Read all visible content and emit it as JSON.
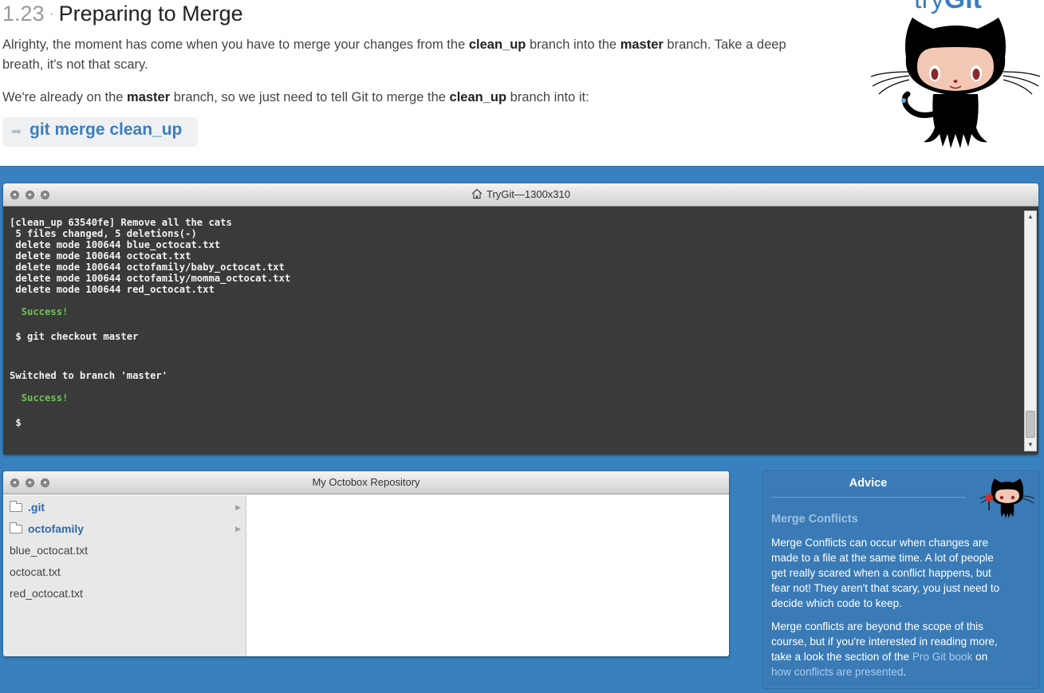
{
  "lesson": {
    "number": "1.23",
    "separator": "·",
    "title": "Preparing to Merge",
    "p1": {
      "a": "Alrighty, the moment has come when you have to merge your changes from the ",
      "b1": "clean_up",
      "c": " branch into the ",
      "b2": "master",
      "d": " branch. Take a deep breath, it's not that scary."
    },
    "p2": {
      "a": "We're already on the ",
      "b1": "master",
      "c": " branch, so we just need to tell Git to merge the ",
      "b2": "clean_up",
      "d": " branch into it:"
    },
    "command": "git merge clean_up"
  },
  "logo": {
    "text_light": "try",
    "text_bold": "Git"
  },
  "terminal": {
    "title": "TryGit—1300x310",
    "lines": [
      "[clean_up 63540fe] Remove all the cats",
      " 5 files changed, 5 deletions(-)",
      " delete mode 100644 blue_octocat.txt",
      " delete mode 100644 octocat.txt",
      " delete mode 100644 octofamily/baby_octocat.txt",
      " delete mode 100644 octofamily/momma_octocat.txt",
      " delete mode 100644 red_octocat.txt",
      "  Success!",
      " $ git checkout master",
      "Switched to branch 'master'",
      "  Success!",
      " $"
    ]
  },
  "repository": {
    "title": "My Octobox Repository",
    "items": [
      {
        "name": ".git",
        "type": "folder"
      },
      {
        "name": "octofamily",
        "type": "folder"
      },
      {
        "name": "blue_octocat.txt",
        "type": "file"
      },
      {
        "name": "octocat.txt",
        "type": "file"
      },
      {
        "name": "red_octocat.txt",
        "type": "file"
      }
    ]
  },
  "advice": {
    "title": "Advice",
    "subtitle": "Merge Conflicts",
    "p1": "Merge Conflicts can occur when changes are made to a file at the same time. A lot of people get really scared when a conflict happens, but fear not! They aren't that scary, you just need to decide which code to keep.",
    "p2_a": "Merge conflicts are beyond the scope of this course, but if you're interested in reading more, take a look the section of the ",
    "p2_link1": "Pro Git book",
    "p2_b": " on ",
    "p2_link2": "how conflicts are presented",
    "p2_c": "."
  },
  "colors": {
    "accent": "#3b7ec0",
    "workspace": "#3880be",
    "terminal_bg": "#3a3a3a",
    "success": "#72c05a"
  },
  "icons": [
    "share-arrow-icon",
    "home-icon",
    "folder-icon",
    "expand-triangle-icon",
    "octocat-logo",
    "octocat-mascot-icon"
  ]
}
